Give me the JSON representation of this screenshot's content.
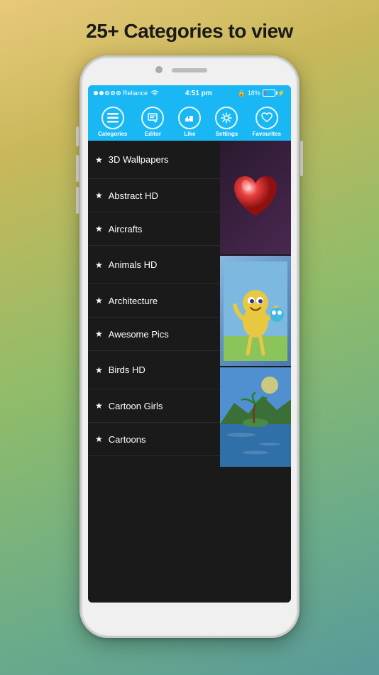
{
  "page": {
    "headline": "25+ Categories to view",
    "status": {
      "carrier": "Reliance",
      "time": "4:51 pm",
      "battery_pct": "18%",
      "signal_dots": [
        "filled",
        "filled",
        "empty",
        "empty",
        "empty"
      ]
    },
    "navbar": {
      "items": [
        {
          "id": "categories",
          "label": "Categories",
          "icon": "≡"
        },
        {
          "id": "editor",
          "label": "Editor",
          "icon": "✏"
        },
        {
          "id": "like",
          "label": "Like",
          "icon": "👍"
        },
        {
          "id": "settings",
          "label": "Settings",
          "icon": "⚙"
        },
        {
          "id": "favourites",
          "label": "Favourites",
          "icon": "♡"
        }
      ]
    },
    "categories": [
      {
        "name": "3D Wallpapers",
        "has_thumb": "heart"
      },
      {
        "name": "Abstract HD",
        "has_thumb": null
      },
      {
        "name": "Aircrafts",
        "has_thumb": null
      },
      {
        "name": "Animals HD",
        "has_thumb": "cartoon"
      },
      {
        "name": "Architecture",
        "has_thumb": null
      },
      {
        "name": "Awesome Pics",
        "has_thumb": null
      },
      {
        "name": "Birds HD",
        "has_thumb": "landscape"
      },
      {
        "name": "Cartoon Girls",
        "has_thumb": null
      },
      {
        "name": "Cartoons",
        "has_thumb": null
      }
    ]
  }
}
